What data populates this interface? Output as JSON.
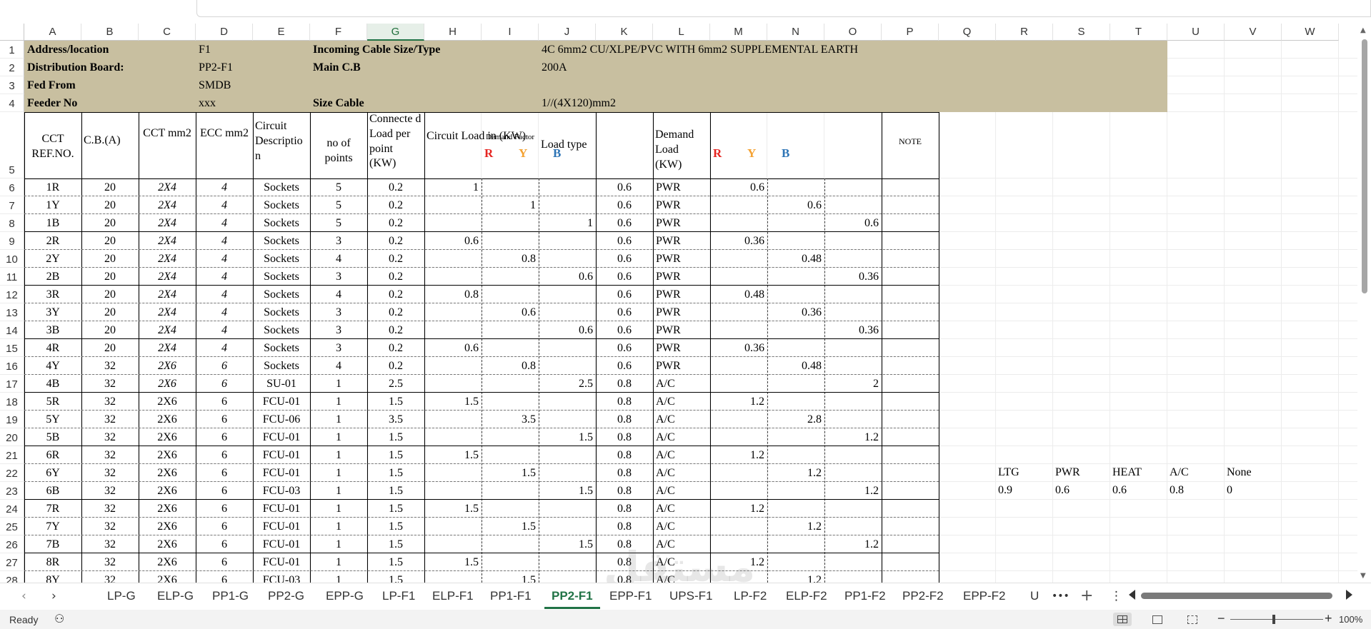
{
  "columns": [
    "A",
    "B",
    "C",
    "D",
    "E",
    "F",
    "G",
    "H",
    "I",
    "J",
    "K",
    "L",
    "M",
    "N",
    "O",
    "P",
    "Q",
    "R",
    "S",
    "T",
    "U",
    "V",
    "W"
  ],
  "selected_column": "G",
  "row_numbers": [
    "1",
    "2",
    "3",
    "4",
    "5",
    "6",
    "7",
    "8",
    "9",
    "10",
    "11",
    "12",
    "13",
    "14",
    "15",
    "16",
    "17",
    "18",
    "19",
    "20",
    "21",
    "22",
    "23",
    "24",
    "25",
    "26",
    "27",
    "28"
  ],
  "header_info": {
    "address_label": "Address/location",
    "address_value": "F1",
    "board_label": "Distribution Board:",
    "board_value": "PP2-F1",
    "fed_label": "Fed From",
    "fed_value": "SMDB",
    "feeder_label": "Feeder No",
    "feeder_value": "xxx",
    "incoming_label": "Incoming Cable Size/Type",
    "incoming_value": "4C 6mm2 CU/XLPE/PVC WITH 6mm2 SUPPLEMENTAL EARTH",
    "main_cb_label": "Main C.B",
    "main_cb_value": "200A",
    "size_cable_label": "Size Cable",
    "size_cable_value": "1//(4X120)mm2"
  },
  "table_headers": {
    "cct_ref": "CCT REF.NO.",
    "cb": "C.B.(A)",
    "cct_mm2": "CCT mm2",
    "ecc_mm2": "ECC mm2",
    "circuit_desc": "Circuit Descriptio n",
    "points": "no of points",
    "connected_load": "Connecte d Load per point (KW)",
    "circuit_load": "Circuit Load in (KW)",
    "demand_factor": "Demand Factor",
    "load_type": "Load type",
    "demand_load": "Demand Load (KW)",
    "note": "NOTE",
    "phase_r": "R",
    "phase_y": "Y",
    "phase_b": "B"
  },
  "phase_colors": {
    "r": "#e52521",
    "y": "#f4a233",
    "b": "#2e75b6"
  },
  "rows": [
    {
      "ref": "1R",
      "cb": "20",
      "cct": "2X4",
      "ecc": "4",
      "desc": "Sockets",
      "pts": "5",
      "load": "0.2",
      "r": "1",
      "y": "",
      "b": "",
      "df": "0.6",
      "type": "PWR",
      "dr": "0.6",
      "dy": "",
      "db": "",
      "style": "italic"
    },
    {
      "ref": "1Y",
      "cb": "20",
      "cct": "2X4",
      "ecc": "4",
      "desc": "Sockets",
      "pts": "5",
      "load": "0.2",
      "r": "",
      "y": "1",
      "b": "",
      "df": "0.6",
      "type": "PWR",
      "dr": "",
      "dy": "0.6",
      "db": "",
      "style": "italic"
    },
    {
      "ref": "1B",
      "cb": "20",
      "cct": "2X4",
      "ecc": "4",
      "desc": "Sockets",
      "pts": "5",
      "load": "0.2",
      "r": "",
      "y": "",
      "b": "1",
      "df": "0.6",
      "type": "PWR",
      "dr": "",
      "dy": "",
      "db": "0.6",
      "style": "italic"
    },
    {
      "ref": "2R",
      "cb": "20",
      "cct": "2X4",
      "ecc": "4",
      "desc": "Sockets",
      "pts": "3",
      "load": "0.2",
      "r": "0.6",
      "y": "",
      "b": "",
      "df": "0.6",
      "type": "PWR",
      "dr": "0.36",
      "dy": "",
      "db": "",
      "style": "italic"
    },
    {
      "ref": "2Y",
      "cb": "20",
      "cct": "2X4",
      "ecc": "4",
      "desc": "Sockets",
      "pts": "4",
      "load": "0.2",
      "r": "",
      "y": "0.8",
      "b": "",
      "df": "0.6",
      "type": "PWR",
      "dr": "",
      "dy": "0.48",
      "db": "",
      "style": "italic"
    },
    {
      "ref": "2B",
      "cb": "20",
      "cct": "2X4",
      "ecc": "4",
      "desc": "Sockets",
      "pts": "3",
      "load": "0.2",
      "r": "",
      "y": "",
      "b": "0.6",
      "df": "0.6",
      "type": "PWR",
      "dr": "",
      "dy": "",
      "db": "0.36",
      "style": "italic"
    },
    {
      "ref": "3R",
      "cb": "20",
      "cct": "2X4",
      "ecc": "4",
      "desc": "Sockets",
      "pts": "4",
      "load": "0.2",
      "r": "0.8",
      "y": "",
      "b": "",
      "df": "0.6",
      "type": "PWR",
      "dr": "0.48",
      "dy": "",
      "db": "",
      "style": "italic"
    },
    {
      "ref": "3Y",
      "cb": "20",
      "cct": "2X4",
      "ecc": "4",
      "desc": "Sockets",
      "pts": "3",
      "load": "0.2",
      "r": "",
      "y": "0.6",
      "b": "",
      "df": "0.6",
      "type": "PWR",
      "dr": "",
      "dy": "0.36",
      "db": "",
      "style": "italic"
    },
    {
      "ref": "3B",
      "cb": "20",
      "cct": "2X4",
      "ecc": "4",
      "desc": "Sockets",
      "pts": "3",
      "load": "0.2",
      "r": "",
      "y": "",
      "b": "0.6",
      "df": "0.6",
      "type": "PWR",
      "dr": "",
      "dy": "",
      "db": "0.36",
      "style": "italic"
    },
    {
      "ref": "4R",
      "cb": "20",
      "cct": "2X4",
      "ecc": "4",
      "desc": "Sockets",
      "pts": "3",
      "load": "0.2",
      "r": "0.6",
      "y": "",
      "b": "",
      "df": "0.6",
      "type": "PWR",
      "dr": "0.36",
      "dy": "",
      "db": "",
      "style": "italic"
    },
    {
      "ref": "4Y",
      "cb": "32",
      "cct": "2X6",
      "ecc": "6",
      "desc": "Sockets",
      "pts": "4",
      "load": "0.2",
      "r": "",
      "y": "0.8",
      "b": "",
      "df": "0.6",
      "type": "PWR",
      "dr": "",
      "dy": "0.48",
      "db": "",
      "style": "italic"
    },
    {
      "ref": "4B",
      "cb": "32",
      "cct": "2X6",
      "ecc": "6",
      "desc": "SU-01",
      "pts": "1",
      "load": "2.5",
      "r": "",
      "y": "",
      "b": "2.5",
      "df": "0.8",
      "type": "A/C",
      "dr": "",
      "dy": "",
      "db": "2",
      "style": "italic"
    },
    {
      "ref": "5R",
      "cb": "32",
      "cct": "2X6",
      "ecc": "6",
      "desc": "FCU-01",
      "pts": "1",
      "load": "1.5",
      "r": "1.5",
      "y": "",
      "b": "",
      "df": "0.8",
      "type": "A/C",
      "dr": "1.2",
      "dy": "",
      "db": "",
      "style": "normal"
    },
    {
      "ref": "5Y",
      "cb": "32",
      "cct": "2X6",
      "ecc": "6",
      "desc": "FCU-06",
      "pts": "1",
      "load": "3.5",
      "r": "",
      "y": "3.5",
      "b": "",
      "df": "0.8",
      "type": "A/C",
      "dr": "",
      "dy": "2.8",
      "db": "",
      "style": "normal"
    },
    {
      "ref": "5B",
      "cb": "32",
      "cct": "2X6",
      "ecc": "6",
      "desc": "FCU-01",
      "pts": "1",
      "load": "1.5",
      "r": "",
      "y": "",
      "b": "1.5",
      "df": "0.8",
      "type": "A/C",
      "dr": "",
      "dy": "",
      "db": "1.2",
      "style": "normal"
    },
    {
      "ref": "6R",
      "cb": "32",
      "cct": "2X6",
      "ecc": "6",
      "desc": "FCU-01",
      "pts": "1",
      "load": "1.5",
      "r": "1.5",
      "y": "",
      "b": "",
      "df": "0.8",
      "type": "A/C",
      "dr": "1.2",
      "dy": "",
      "db": "",
      "style": "normal"
    },
    {
      "ref": "6Y",
      "cb": "32",
      "cct": "2X6",
      "ecc": "6",
      "desc": "FCU-01",
      "pts": "1",
      "load": "1.5",
      "r": "",
      "y": "1.5",
      "b": "",
      "df": "0.8",
      "type": "A/C",
      "dr": "",
      "dy": "1.2",
      "db": "",
      "style": "normal"
    },
    {
      "ref": "6B",
      "cb": "32",
      "cct": "2X6",
      "ecc": "6",
      "desc": "FCU-03",
      "pts": "1",
      "load": "1.5",
      "r": "",
      "y": "",
      "b": "1.5",
      "df": "0.8",
      "type": "A/C",
      "dr": "",
      "dy": "",
      "db": "1.2",
      "style": "normal"
    },
    {
      "ref": "7R",
      "cb": "32",
      "cct": "2X6",
      "ecc": "6",
      "desc": "FCU-01",
      "pts": "1",
      "load": "1.5",
      "r": "1.5",
      "y": "",
      "b": "",
      "df": "0.8",
      "type": "A/C",
      "dr": "1.2",
      "dy": "",
      "db": "",
      "style": "normal"
    },
    {
      "ref": "7Y",
      "cb": "32",
      "cct": "2X6",
      "ecc": "6",
      "desc": "FCU-01",
      "pts": "1",
      "load": "1.5",
      "r": "",
      "y": "1.5",
      "b": "",
      "df": "0.8",
      "type": "A/C",
      "dr": "",
      "dy": "1.2",
      "db": "",
      "style": "normal"
    },
    {
      "ref": "7B",
      "cb": "32",
      "cct": "2X6",
      "ecc": "6",
      "desc": "FCU-01",
      "pts": "1",
      "load": "1.5",
      "r": "",
      "y": "",
      "b": "1.5",
      "df": "0.8",
      "type": "A/C",
      "dr": "",
      "dy": "",
      "db": "1.2",
      "style": "normal"
    },
    {
      "ref": "8R",
      "cb": "32",
      "cct": "2X6",
      "ecc": "6",
      "desc": "FCU-01",
      "pts": "1",
      "load": "1.5",
      "r": "1.5",
      "y": "",
      "b": "",
      "df": "0.8",
      "type": "A/C",
      "dr": "1.2",
      "dy": "",
      "db": "",
      "style": "normal"
    },
    {
      "ref": "8Y",
      "cb": "32",
      "cct": "2X6",
      "ecc": "6",
      "desc": "FCU-03",
      "pts": "1",
      "load": "1.5",
      "r": "",
      "y": "1.5",
      "b": "",
      "df": "0.8",
      "type": "A/C",
      "dr": "",
      "dy": "1.2",
      "db": "",
      "style": "normal"
    }
  ],
  "demand_factor_legend": {
    "labels": [
      "LTG",
      "PWR",
      "HEAT",
      "A/C",
      "None"
    ],
    "values": [
      "0.9",
      "0.6",
      "0.6",
      "0.8",
      "0"
    ]
  },
  "sheet_tabs": [
    "LP-G",
    "ELP-G",
    "PP1-G",
    "PP2-G",
    "EPP-G",
    "LP-F1",
    "ELP-F1",
    "PP1-F1",
    "PP2-F1",
    "EPP-F1",
    "UPS-F1",
    "LP-F2",
    "ELP-F2",
    "PP1-F2",
    "PP2-F2",
    "EPP-F2",
    "U"
  ],
  "active_tab": "PP2-F1",
  "tab_controls": {
    "more": "•••",
    "add": "+",
    "menu": "⋮",
    "prev": "‹",
    "next": "›"
  },
  "status": {
    "ready": "Ready",
    "zoom": "100%"
  },
  "watermark": {
    "arabic": "مستقل",
    "latin": "mostaql.com"
  }
}
